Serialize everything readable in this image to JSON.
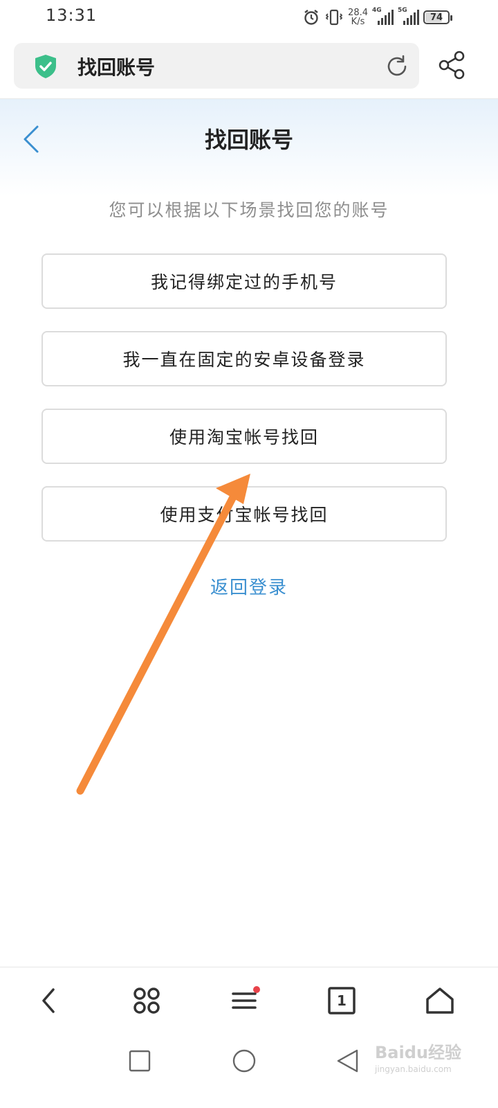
{
  "status_bar": {
    "time": "13:31",
    "net_speed_value": "28.4",
    "net_speed_unit": "K/s",
    "sim1_label": "4G",
    "sim2_label": "5G",
    "battery": "74"
  },
  "address_bar": {
    "title": "找回账号"
  },
  "page": {
    "title": "找回账号",
    "subtitle": "您可以根据以下场景找回您的账号",
    "options": [
      "我记得绑定过的手机号",
      "我一直在固定的安卓设备登录",
      "使用淘宝帐号找回",
      "使用支付宝帐号找回"
    ],
    "back_login": "返回登录"
  },
  "watermark": {
    "line1": "Baidu经验",
    "line2": "jingyan.baidu.com"
  },
  "colors": {
    "accent_blue": "#3a8fd0",
    "shield_green": "#3cbf8a",
    "annotation_arrow": "#f58a3a"
  },
  "icons": {
    "status": [
      "alarm-icon",
      "vibrate-icon",
      "signal-icon",
      "battery-icon"
    ],
    "address_bar": [
      "shield-check-icon",
      "reload-icon",
      "share-icon"
    ],
    "browser_nav": [
      "back-icon",
      "apps-icon",
      "menu-icon",
      "tabs-icon",
      "home-icon"
    ],
    "system_nav": [
      "recents-icon",
      "home-circle-icon",
      "back-triangle-icon"
    ]
  },
  "browser_nav": {
    "tab_count": "1"
  }
}
